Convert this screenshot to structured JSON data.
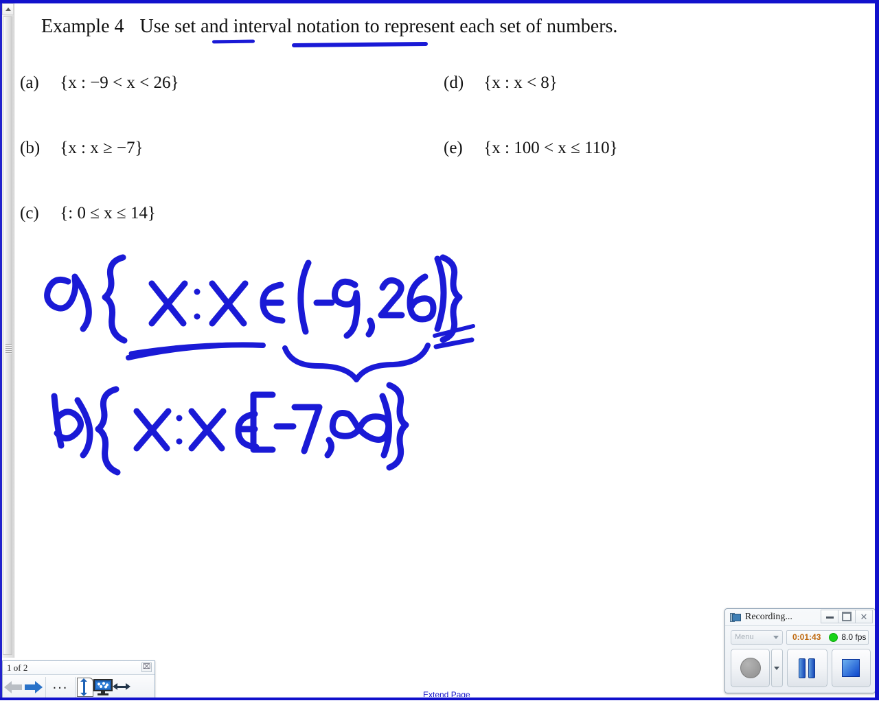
{
  "document": {
    "heading_label": "Example 4",
    "heading_prompt": "Use set and interval notation to represent each set of numbers.",
    "items": [
      {
        "tag": "(a)",
        "expr": "{x : −9 < x < 26}"
      },
      {
        "tag": "(b)",
        "expr": "{x : x ≥ −7}"
      },
      {
        "tag": "(c)",
        "expr": "{: 0 ≤ x ≤ 14}"
      },
      {
        "tag": "(d)",
        "expr": "{x : x < 8}"
      },
      {
        "tag": "(e)",
        "expr": "{x : 100 < x ≤ 110}"
      }
    ],
    "ink_annotations": [
      {
        "label": "a)",
        "text": "{x : x ∈ (−9, 26)}"
      },
      {
        "label": "b)",
        "text": "{x : x ∈ [−7, ∞)}"
      }
    ],
    "extend_page_label": "Extend Page",
    "ink_color": "#1a1ad6"
  },
  "page_nav": {
    "page_counter": "1 of 2",
    "close_label": "⌧",
    "back_label": "Previous page",
    "forward_label": "Next page",
    "more_label": "...",
    "page_height_label": "Page height",
    "screen_label": "Screen view",
    "width_label": "Page width"
  },
  "recording": {
    "title": "Recording...",
    "minimize_label": "Minimize",
    "restore_label": "Restore",
    "close_label": "✕",
    "menu_label": "Menu",
    "timer": "0:01:43",
    "fps": "8.0 fps",
    "led_color": "#18d418",
    "record_label": "Record",
    "record_options_label": "Record options",
    "pause_label": "Pause",
    "stop_label": "Stop"
  }
}
